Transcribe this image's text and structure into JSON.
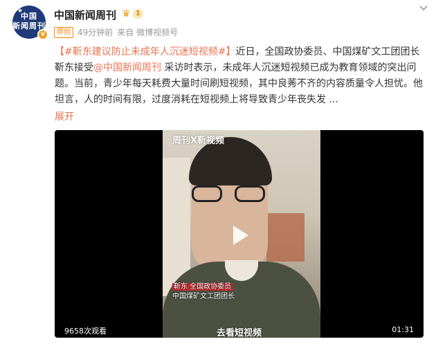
{
  "account": {
    "name": "中国新闻周刊",
    "level": "1",
    "avatar_text_line1": "中国",
    "avatar_text_line2": "新闻周刊"
  },
  "meta": {
    "original_tag": "原创",
    "time": "49分钟前",
    "source": "来自 微博视频号"
  },
  "post": {
    "hashtag": "【#靳东建议防止未成年人沉迷短视频#】",
    "text_part1": "近日，全国政协委员、中国煤矿文工团团长靳东接受",
    "mention": "@中国新闻周刊",
    "text_part2": " 采访时表示，未成年人沉迷短视频已成为教育领域的突出问题。当前，青少年每天耗费大量时间刷短视频，其中良莠不齐的内容质量令人担忧。他坦言，人的时间有限，过度消耗在短视频上将导致青少年丧失发 ...",
    "expand_label": "展开"
  },
  "video": {
    "watermark": "周刊X靳视频",
    "caption_name": "靳东 全国政协委员",
    "caption_title": "中国煤矿文工团团长",
    "subtitle": "去看短视频",
    "views": "9658次观看",
    "duration": "01:31"
  },
  "icons": {
    "verified": "verified-badge-icon",
    "crown": "crown-icon",
    "more": "chevron-down-icon",
    "play": "play-icon"
  },
  "colors": {
    "accent": "#eb7350",
    "orange_tag": "#ff8200",
    "avatar_bg": "#1f3a78"
  }
}
